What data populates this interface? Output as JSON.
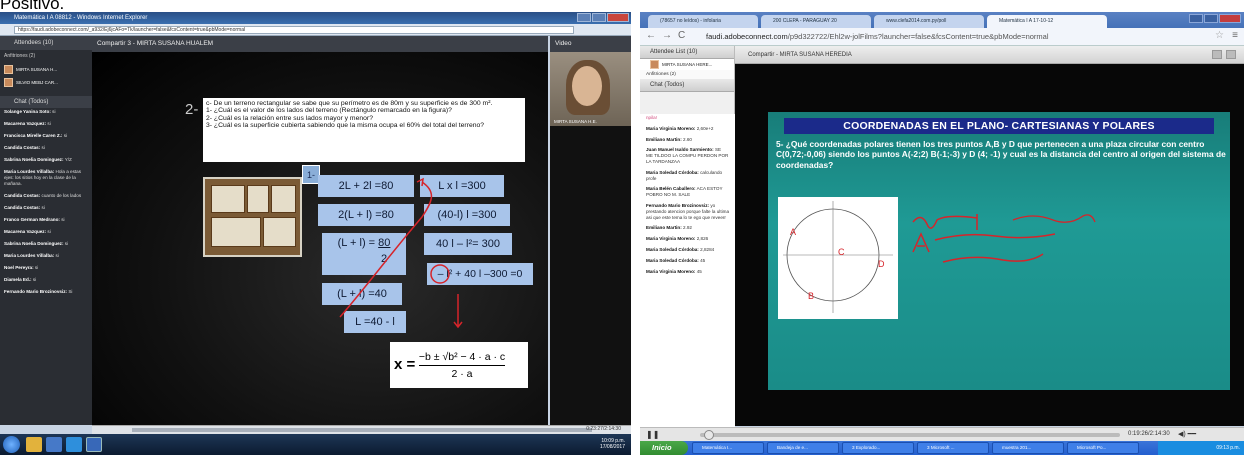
{
  "caption": "Positivo.",
  "left": {
    "window_title": "Matemática I A 08812 - Windows Internet Explorer",
    "url": "https://faudi.adobeconnect.com/_a932/Ej6jcAFo=Tk/launcher=false&fcsContent=true&pbMode=normal",
    "attendees_header": "Attendees (10)",
    "attendees_sub": "Anfitriones (2)",
    "attendees": [
      "MIRTA SUSANA H...",
      "SILVIO MEBJ CAR..."
    ],
    "chat_header": "Chat  (Todos)",
    "chat": [
      {
        "name": "Solange Yanina Soto:",
        "msg": "si"
      },
      {
        "name": "Macarena Vazquez:",
        "msg": "si"
      },
      {
        "name": "Francisca Mirelle Caren Z.:",
        "msg": "si"
      },
      {
        "name": "Candida Costas:",
        "msg": "si"
      },
      {
        "name": "Sabrina Noelia Dominguez:",
        "msg": "Y/Z"
      },
      {
        "name": "Maria Lourdes Villalba:",
        "msg": "Hola a estas ejes: los sitios hoy en la clase de la mañana."
      },
      {
        "name": "Candida Costas:",
        "msg": "cuanto de los lados"
      },
      {
        "name": "Candida Costas:",
        "msg": "si"
      },
      {
        "name": "Franco German Medrano:",
        "msg": "si"
      },
      {
        "name": "Macarena Vazquez:",
        "msg": "si"
      },
      {
        "name": "Sabrina Noelia Dominguez:",
        "msg": "si"
      },
      {
        "name": "Maria Lourdes Villalba:",
        "msg": "si"
      },
      {
        "name": "Noel Pereyra:",
        "msg": "si"
      },
      {
        "name": "Diamela Ed.:",
        "msg": "si"
      },
      {
        "name": "Fernando Mario Brozinovsiz:",
        "msg": "Si"
      }
    ],
    "share_header": "Compartir 3 - MIRTA SUSANA HUALEM",
    "video_header": "Video",
    "video_label": "MIRTA SUSANA H.E.",
    "problem_number": "2-",
    "problem_lines": [
      "c- De un terreno rectangular se sabe que su perímetro es de 80m y su superficie es de 300 m².",
      "1- ¿Cuál es el valor de los lados del terreno (Rectángulo remarcado en la figura)?",
      "2- ¿Cuál es la relación entre sus lados mayor y menor?",
      "3- ¿Cuál es la superficie cubierta sabiendo que la misma ocupa el 60% del total del terreno?"
    ],
    "step_label": "1-",
    "equations": {
      "e1": "2L + 2l =80",
      "e2": "2(L + l) =80",
      "e3_top": "(L + l) =",
      "e3_num": "80",
      "e3_den": "2",
      "e4": "(L + l) =40",
      "e5": "L  =40 - l",
      "e6": "L x l =300",
      "e7": "(40-l) l =300",
      "e8": "40 l – l²= 300",
      "e9": "– l² + 40 l –300 =0"
    },
    "formula": "x = (−b ± √(b² − 4·a·c)) / (2·a)",
    "formula_x": "x =",
    "formula_num": "−b ± √b² − 4 · a · c",
    "formula_den": "2 · a",
    "timecode": "0:23:27/2:14:30",
    "tray_time": "10:09 p.m.",
    "tray_date": "17/08/2017"
  },
  "right": {
    "tabs": [
      "(78657 no leídos) - infolaria",
      "200 CLEPA - PARAGUAY 20",
      "www.clefa2014.com.py/poll",
      "Matemática I A 17-10-12"
    ],
    "url_host": "faudi.adobeconnect.com",
    "url_rest": "/p9d322722/Ehl2w-jolFilms?launcher=false&fcsContent=true&pbMode=normal",
    "attendees_header": "Attendee List  (10)",
    "host": "MIRTA SUSANA HERE...",
    "hosts_sub": "Anfitriones (2)",
    "chat_header": "Chat  (Todos)",
    "chat": [
      {
        "name": "",
        "msg": "npila!",
        "pink": true
      },
      {
        "name": "Maria Virginia Moreno:",
        "msg": "2,60e+2"
      },
      {
        "name": "Emiliano Martin:",
        "msg": "2.60"
      },
      {
        "name": "Juan Manuel Isaldo Sarmiento:",
        "msg": "SE ME TILDOO LA COMPU PERDON POR LA TARDANZAA"
      },
      {
        "name": "Maria Soledad Córdoba:",
        "msg": "calculando profe"
      },
      {
        "name": "Maria Belén Caballero:",
        "msg": "ACA ESTOY POBRO NO M. SALE"
      },
      {
        "name": "Fernando Mario Brozinovsiz:",
        "msg": "yo prestando atencion porque falte la ultima asi que este tema lo te ego que reveerr"
      },
      {
        "name": "Emiliano Martin:",
        "msg": "2.92"
      },
      {
        "name": "Maria Virginia Moreno:",
        "msg": "2,826"
      },
      {
        "name": "Maria Soledad Córdoba:",
        "msg": "2,8284"
      },
      {
        "name": "Maria Soledad Córdoba:",
        "msg": "45"
      },
      {
        "name": "Maria Virginia Moreno:",
        "msg": "45"
      }
    ],
    "share_header": "Compartir - MIRTA SUSANA HEREDIA",
    "slide_title": "COORDENADAS EN EL PLANO- CARTESIANAS Y POLARES",
    "slide_question": "5- ¿Qué coordenadas polares tienen los tres puntos A,B y D que pertenecen a una plaza circular con centro C(0,72;-0,06) siendo los puntos  A(-2;2)  B(-1;-3) y D (4; -1) y cual es la distancia del centro al origen del sistema de coordenadas?",
    "timecode": "0:19:26/2:14:30",
    "taskbar_start": "Inicio",
    "taskbar_items": [
      "Matemática I...",
      "Bandeja de e...",
      "3 Explorado...",
      "3 Microsoft ...",
      "muestra 201...",
      "Microsoft Po..."
    ],
    "tray_time": "09:13 p.m."
  }
}
